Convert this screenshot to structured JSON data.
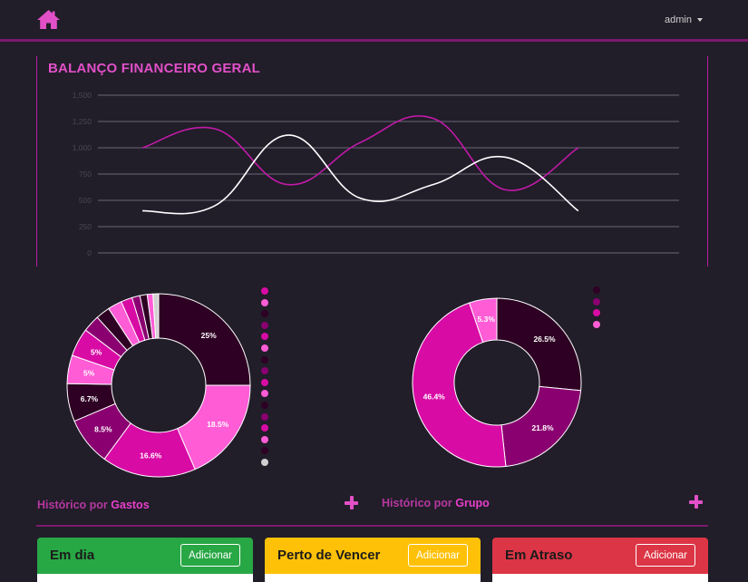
{
  "header": {
    "user_label": "admin"
  },
  "balance_panel": {
    "title": "BALANÇO FINANCEIRO GERAL"
  },
  "chart_data": [
    {
      "type": "line",
      "title": "BALANÇO FINANCEIRO GERAL",
      "y_ticks": [
        "0",
        "250",
        "500",
        "750",
        "1,000",
        "1,250",
        "1,500"
      ],
      "ylim": [
        0,
        1500
      ],
      "x_count": 8,
      "grid": true,
      "series": [
        {
          "color": "#c21aa8",
          "values": [
            1000,
            1180,
            650,
            1050,
            1280,
            600,
            1000
          ]
        },
        {
          "color": "#ffffff",
          "values": [
            400,
            450,
            1120,
            520,
            650,
            910,
            400
          ]
        }
      ],
      "series_x_positions": [
        0,
        1,
        2,
        3,
        4,
        5,
        6
      ]
    },
    {
      "type": "pie",
      "donut": true,
      "slices": [
        {
          "value": 25,
          "label": "25%",
          "color": "#2e0023"
        },
        {
          "value": 18.5,
          "label": "18.5%",
          "color": "#ff5cd6"
        },
        {
          "value": 16.6,
          "label": "16.6%",
          "color": "#d80ba5"
        },
        {
          "value": 8.5,
          "label": "8.5%",
          "color": "#8a0070"
        },
        {
          "value": 6.7,
          "label": "6.7%",
          "color": "#2e0023"
        },
        {
          "value": 5,
          "label": "5%",
          "color": "#ff5cd6"
        },
        {
          "value": 5,
          "label": "5%",
          "color": "#d80ba5"
        },
        {
          "value": 3,
          "label": "",
          "color": "#8a0070"
        },
        {
          "value": 2.5,
          "label": "",
          "color": "#2e0023"
        },
        {
          "value": 2.5,
          "label": "",
          "color": "#ff5cd6"
        },
        {
          "value": 2,
          "label": "",
          "color": "#d80ba5"
        },
        {
          "value": 1.4,
          "label": "",
          "color": "#8a0070"
        },
        {
          "value": 1.3,
          "label": "",
          "color": "#2e0023"
        },
        {
          "value": 1,
          "label": "",
          "color": "#ff5cd6"
        },
        {
          "value": 1,
          "label": "",
          "color": "#d0d0d0"
        }
      ],
      "legend_colors": [
        "#d80ba5",
        "#ff5cd6",
        "#2e0023",
        "#8a0070",
        "#d80ba5",
        "#ff5cd6",
        "#2e0023",
        "#8a0070",
        "#d80ba5",
        "#ff5cd6",
        "#2e0023",
        "#8a0070",
        "#d80ba5",
        "#ff5cd6",
        "#2e0023",
        "#d0d0d0"
      ]
    },
    {
      "type": "pie",
      "donut": true,
      "slices": [
        {
          "value": 26.5,
          "label": "26.5%",
          "color": "#2e0023"
        },
        {
          "value": 21.8,
          "label": "21.8%",
          "color": "#8a0070"
        },
        {
          "value": 46.4,
          "label": "46.4%",
          "color": "#d80ba5"
        },
        {
          "value": 5.3,
          "label": "5.3%",
          "color": "#ff5cd6"
        }
      ],
      "legend_colors": [
        "#2e0023",
        "#8a0070",
        "#d80ba5",
        "#ff5cd6"
      ]
    }
  ],
  "history": {
    "gastos_prefix": "Histórico por ",
    "gastos_bold": "Gastos",
    "grupo_prefix": "Histórico por ",
    "grupo_bold": "Grupo"
  },
  "status_cards": [
    {
      "title": "Em dia",
      "button": "Adicionar",
      "color": "#28a745"
    },
    {
      "title": "Perto de Vencer",
      "button": "Adicionar",
      "color": "#ffc107"
    },
    {
      "title": "Em Atraso",
      "button": "Adicionar",
      "color": "#dc3545"
    }
  ]
}
